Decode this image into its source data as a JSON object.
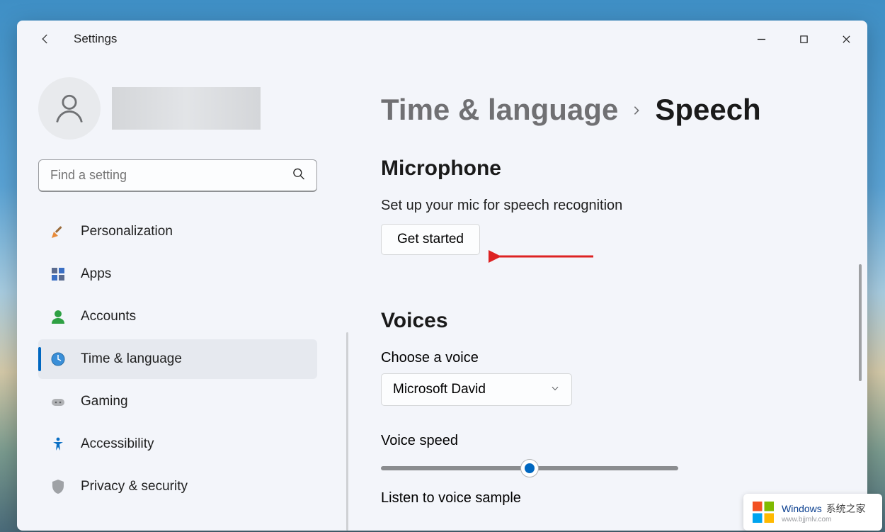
{
  "app": {
    "title": "Settings"
  },
  "search": {
    "placeholder": "Find a setting"
  },
  "sidebar": {
    "items": [
      {
        "label": "Personalization",
        "icon": "personalization-icon"
      },
      {
        "label": "Apps",
        "icon": "apps-icon"
      },
      {
        "label": "Accounts",
        "icon": "accounts-icon"
      },
      {
        "label": "Time & language",
        "icon": "time-language-icon",
        "selected": true
      },
      {
        "label": "Gaming",
        "icon": "gaming-icon"
      },
      {
        "label": "Accessibility",
        "icon": "accessibility-icon"
      },
      {
        "label": "Privacy & security",
        "icon": "privacy-security-icon"
      }
    ]
  },
  "breadcrumb": {
    "parent": "Time & language",
    "current": "Speech"
  },
  "microphone": {
    "heading": "Microphone",
    "description": "Set up your mic for speech recognition",
    "button": "Get started"
  },
  "voices": {
    "heading": "Voices",
    "choose_label": "Choose a voice",
    "selected": "Microsoft David",
    "speed_label": "Voice speed",
    "sample_label": "Listen to voice sample",
    "slider_position_pct": 50
  },
  "watermark": {
    "brand": "Windows",
    "cn": "系统之家",
    "url": "www.bjjmlv.com"
  }
}
